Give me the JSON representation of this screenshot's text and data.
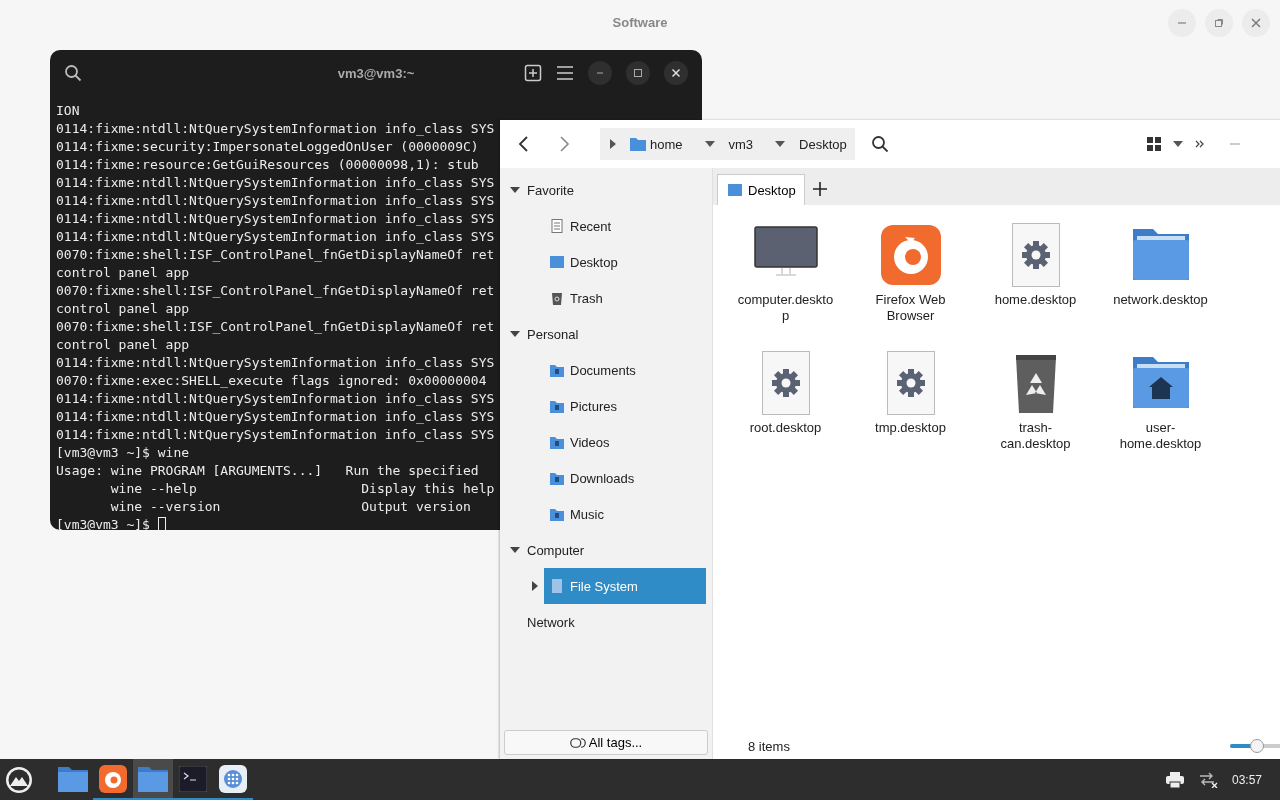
{
  "background_window": {
    "title": "Software"
  },
  "terminal": {
    "title": "vm3@vm3:~",
    "lines": [
      "ION",
      "0114:fixme:ntdll:NtQuerySystemInformation info_class SYS",
      "0114:fixme:security:ImpersonateLoggedOnUser (0000009C)",
      "0114:fixme:resource:GetGuiResources (00000098,1): stub",
      "0114:fixme:ntdll:NtQuerySystemInformation info_class SYS",
      "0114:fixme:ntdll:NtQuerySystemInformation info_class SYS",
      "0114:fixme:ntdll:NtQuerySystemInformation info_class SYS",
      "0114:fixme:ntdll:NtQuerySystemInformation info_class SYS",
      "0070:fixme:shell:ISF_ControlPanel_fnGetDisplayNameOf ret",
      "control panel app",
      "0070:fixme:shell:ISF_ControlPanel_fnGetDisplayNameOf ret",
      "control panel app",
      "0070:fixme:shell:ISF_ControlPanel_fnGetDisplayNameOf ret",
      "control panel app",
      "0114:fixme:ntdll:NtQuerySystemInformation info_class SYS",
      "0070:fixme:exec:SHELL_execute flags ignored: 0x00000004",
      "0114:fixme:ntdll:NtQuerySystemInformation info_class SYS",
      "0114:fixme:ntdll:NtQuerySystemInformation info_class SYS",
      "0114:fixme:ntdll:NtQuerySystemInformation info_class SYS",
      "[vm3@vm3 ~]$ wine",
      "Usage: wine PROGRAM [ARGUMENTS...]   Run the specified",
      "       wine --help                     Display this help",
      "       wine --version                  Output version"
    ],
    "prompt": "[vm3@vm3 ~]$"
  },
  "file_manager": {
    "path": [
      {
        "label": "home",
        "kind": "folder"
      },
      {
        "label": "vm3",
        "kind": "plain"
      },
      {
        "label": "Desktop",
        "kind": "plain"
      }
    ],
    "sidebar": [
      {
        "label": "Favorite",
        "expanded": true,
        "children": [
          {
            "label": "Recent",
            "kind": "recent",
            "selected": false
          },
          {
            "label": "Desktop",
            "kind": "desktop",
            "selected": false
          },
          {
            "label": "Trash",
            "kind": "trash",
            "selected": false
          }
        ]
      },
      {
        "label": "Personal",
        "expanded": true,
        "children": [
          {
            "label": "Documents",
            "kind": "documents",
            "selected": false
          },
          {
            "label": "Pictures",
            "kind": "pictures",
            "selected": false
          },
          {
            "label": "Videos",
            "kind": "videos",
            "selected": false
          },
          {
            "label": "Downloads",
            "kind": "downloads",
            "selected": false
          },
          {
            "label": "Music",
            "kind": "music",
            "selected": false
          }
        ]
      },
      {
        "label": "Computer",
        "expanded": true,
        "children": [
          {
            "label": "File System",
            "kind": "drive",
            "selected": true,
            "expanded": false
          }
        ]
      },
      {
        "label": "Network"
      }
    ],
    "tags_button": "All tags...",
    "tabs": [
      {
        "label": "Desktop",
        "selected": true
      }
    ],
    "files": [
      {
        "name": "computer.desktop",
        "kind": "monitor"
      },
      {
        "name": "Firefox Web Browser",
        "kind": "browser"
      },
      {
        "name": "home.desktop",
        "kind": "settings-file"
      },
      {
        "name": "network.desktop",
        "kind": "folder"
      },
      {
        "name": "root.desktop",
        "kind": "settings-file"
      },
      {
        "name": "tmp.desktop",
        "kind": "settings-file"
      },
      {
        "name": "trash-can.desktop",
        "kind": "trash"
      },
      {
        "name": "user-home.desktop",
        "kind": "home-folder"
      }
    ],
    "status": "8 items",
    "zoom": {
      "level": 0.45
    }
  },
  "taskbar": {
    "items": [
      {
        "kind": "folder",
        "running": false,
        "selected": false
      },
      {
        "kind": "browser",
        "running": true,
        "selected": false
      },
      {
        "kind": "folder",
        "running": true,
        "selected": true
      },
      {
        "kind": "terminal",
        "running": true,
        "selected": false
      },
      {
        "kind": "apps",
        "running": true,
        "selected": false
      }
    ],
    "clock": "03:57"
  }
}
